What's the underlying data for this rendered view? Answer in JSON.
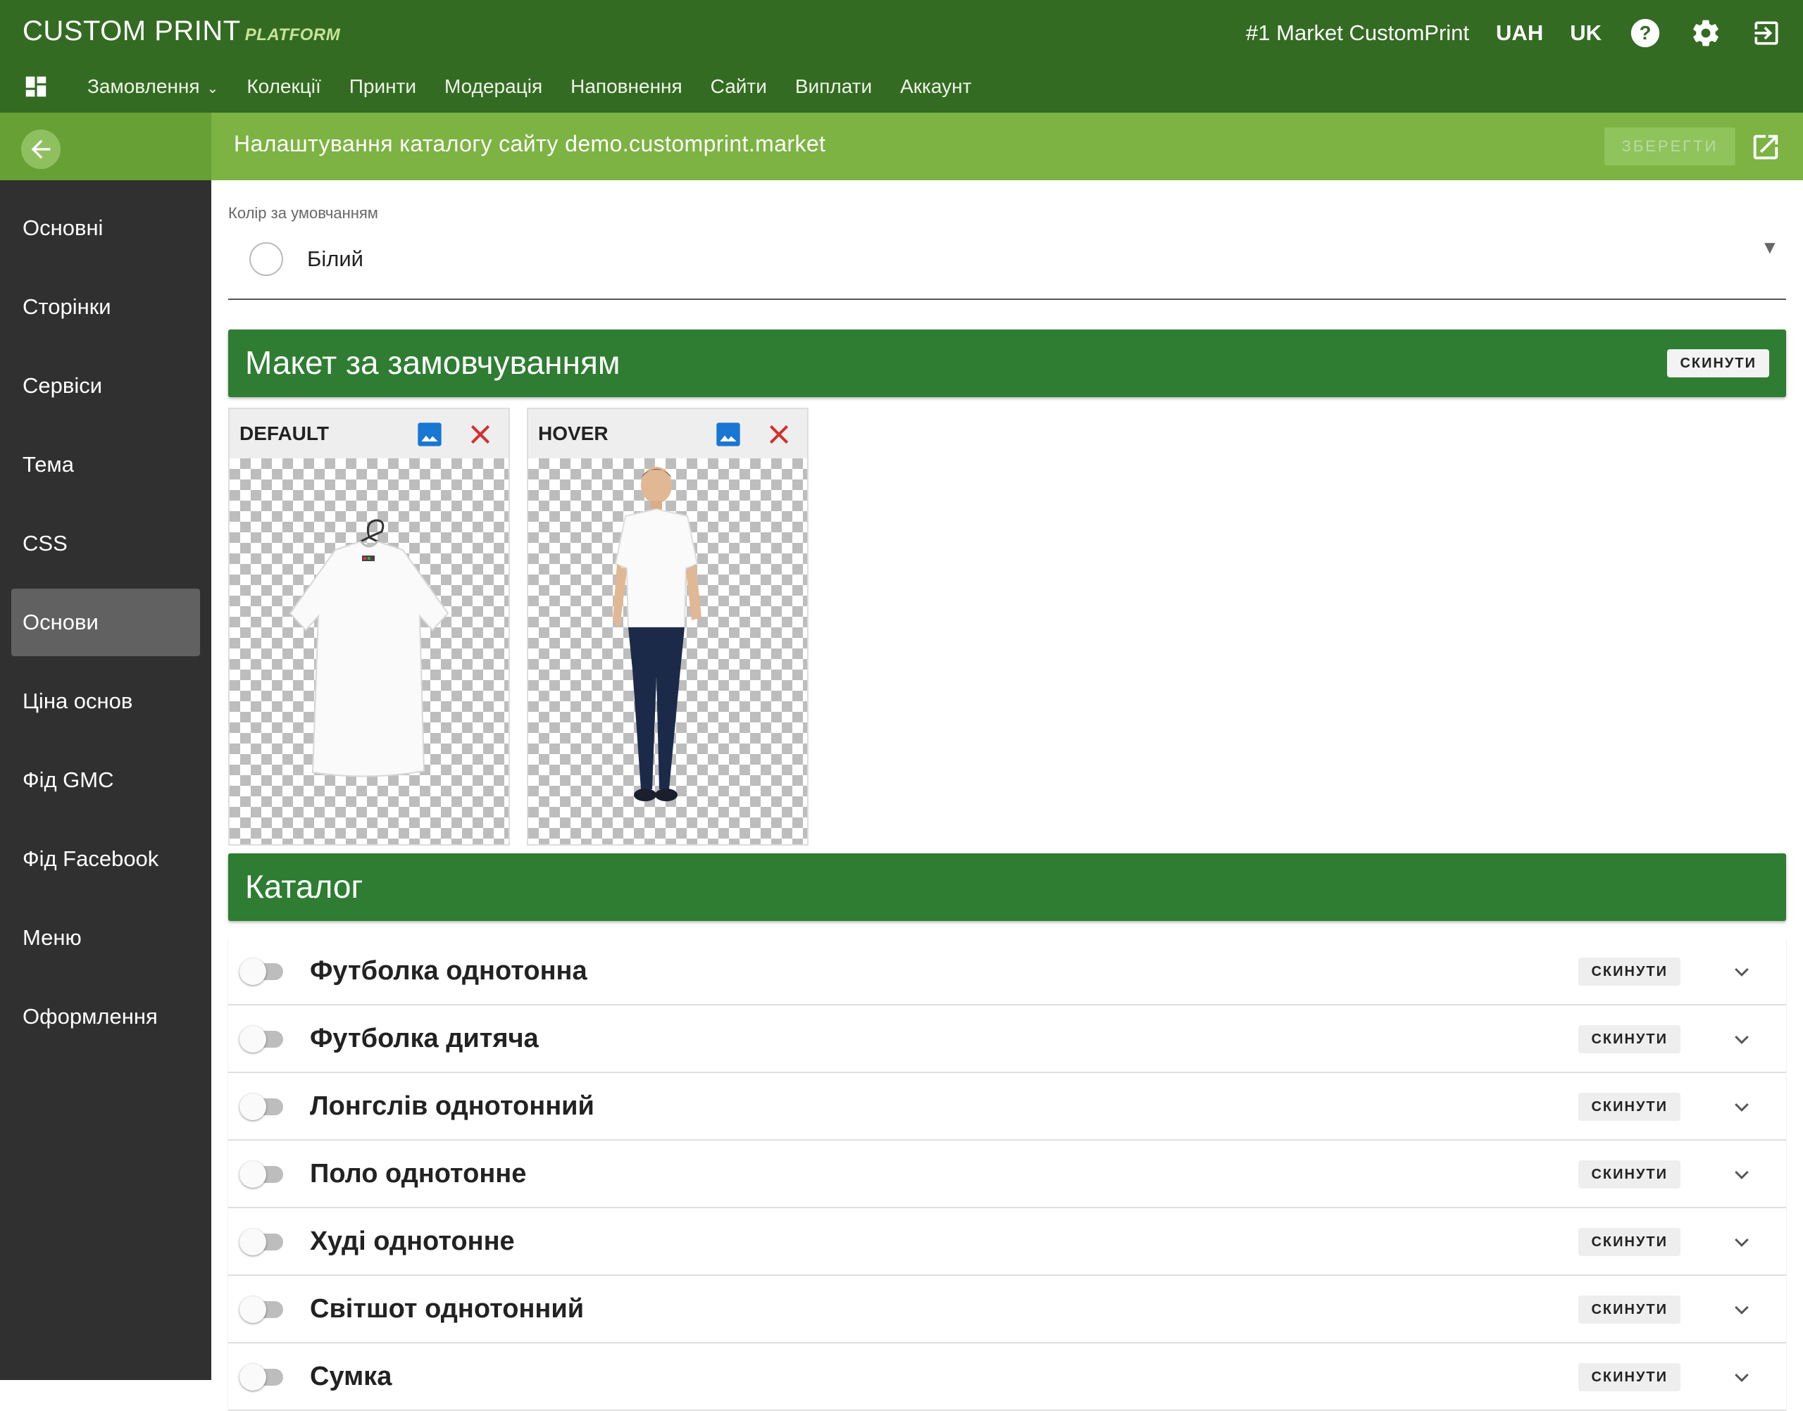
{
  "app": {
    "brand_main": "CUSTOM PRINT",
    "brand_sub": "PLATFORM"
  },
  "header": {
    "market": "#1 Market CustomPrint",
    "currency": "UAH",
    "language": "UK",
    "icons": [
      "help-icon",
      "settings-icon",
      "logout-icon"
    ]
  },
  "nav": {
    "items": [
      "Замовлення",
      "Колекції",
      "Принти",
      "Модерація",
      "Наповнення",
      "Сайти",
      "Виплати",
      "Аккаунт"
    ]
  },
  "subheader": {
    "title": "Налаштування каталогу сайту demo.customprint.market",
    "save_label": "ЗБЕРЕГТИ"
  },
  "sidebar": {
    "items": [
      "Основні",
      "Сторінки",
      "Сервіси",
      "Тема",
      "CSS",
      "Основи",
      "Ціна основ",
      "Фід GMC",
      "Фід Facebook",
      "Меню",
      "Оформлення"
    ],
    "active": "Основи"
  },
  "color_field": {
    "label": "Колір за умовчанням",
    "value": "Білий"
  },
  "layout_panel": {
    "title": "Макет за замовчуванням",
    "reset_label": "СКИНУТИ",
    "cards": [
      {
        "label": "DEFAULT",
        "image": "white t-shirt on hanger"
      },
      {
        "label": "HOVER",
        "image": "man wearing white t-shirt and jeans"
      }
    ]
  },
  "catalog": {
    "title": "Каталог",
    "reset_label": "СКИНУТИ",
    "items": [
      {
        "name": "Футболка однотонна",
        "enabled": false
      },
      {
        "name": "Футболка дитяча",
        "enabled": false
      },
      {
        "name": "Лонгслів однотонний",
        "enabled": false
      },
      {
        "name": "Поло однотонне",
        "enabled": false
      },
      {
        "name": "Худі однотонне",
        "enabled": false
      },
      {
        "name": "Світшот однотонний",
        "enabled": false
      },
      {
        "name": "Сумка",
        "enabled": false
      }
    ]
  },
  "colors": {
    "header": "#336b22",
    "subheader": "#7cb342",
    "panel": "#2e7d32",
    "sidebar": "#303030",
    "sidebar_active": "#616161",
    "icon_blue": "#1976d2",
    "icon_red": "#d32f2f"
  }
}
